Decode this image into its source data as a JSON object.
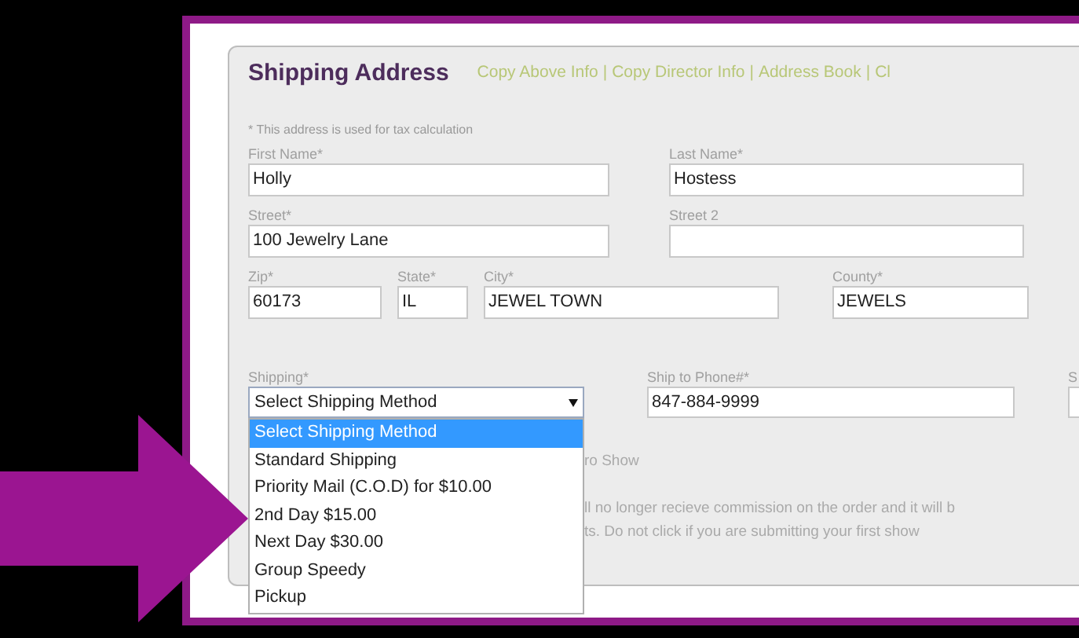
{
  "section": {
    "title": "Shipping Address",
    "links": [
      "Copy Above Info",
      "Copy Director Info",
      "Address Book",
      "Cl"
    ],
    "link_separator": "|",
    "note": "* This address is used for tax calculation"
  },
  "rows": [
    [
      {
        "label": "First Name*",
        "value": "Holly"
      },
      {
        "label": "Last Name*",
        "value": "Hostess"
      }
    ],
    [
      {
        "label": "Street*",
        "value": "100 Jewelry Lane"
      },
      {
        "label": "Street 2"
      }
    ],
    [
      {
        "label": "Zip*",
        "value": "60173"
      },
      {
        "label": "State*",
        "value": "IL"
      },
      {
        "label": "City*",
        "value": "JEWEL TOWN"
      },
      {
        "label": "County*",
        "value": "JEWELS"
      }
    ]
  ],
  "shipping": {
    "label": "Shipping*",
    "value": "Select Shipping Method",
    "expanded": true,
    "options": [
      {
        "label": "Select Shipping Method",
        "selected": true
      },
      {
        "label": "Standard Shipping",
        "selected": false
      },
      {
        "label": "Priority Mail (C.O.D) for $10.00",
        "selected": false
      },
      {
        "label": "2nd Day $15.00",
        "selected": false
      },
      {
        "label": "Next Day $30.00",
        "selected": false
      },
      {
        "label": "Group Speedy",
        "selected": false
      },
      {
        "label": "Pickup",
        "selected": false
      }
    ]
  },
  "phone": {
    "label": "Ship to Phone#*",
    "value": "847-884-9999"
  },
  "column_3": {
    "label": "S"
  },
  "partial_texts": [
    "ro Show",
    "ll no longer recieve commission on the order and it will b",
    "ts. Do not click if you are submitting your first show"
  ]
}
